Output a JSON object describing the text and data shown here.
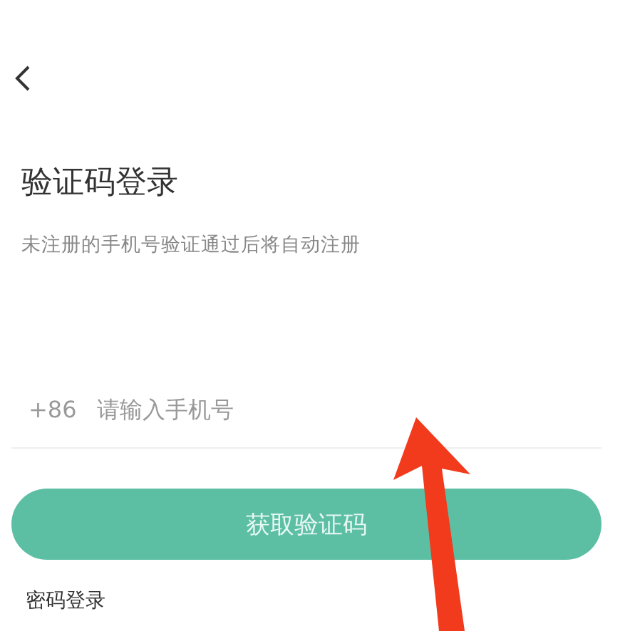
{
  "title": "验证码登录",
  "subtitle": "未注册的手机号验证通过后将自动注册",
  "phone_field": {
    "country_code": "+86",
    "placeholder": "请输入手机号"
  },
  "submit_button": {
    "label": "获取验证码",
    "disabled": true
  },
  "alt_login_link": "密码登录"
}
